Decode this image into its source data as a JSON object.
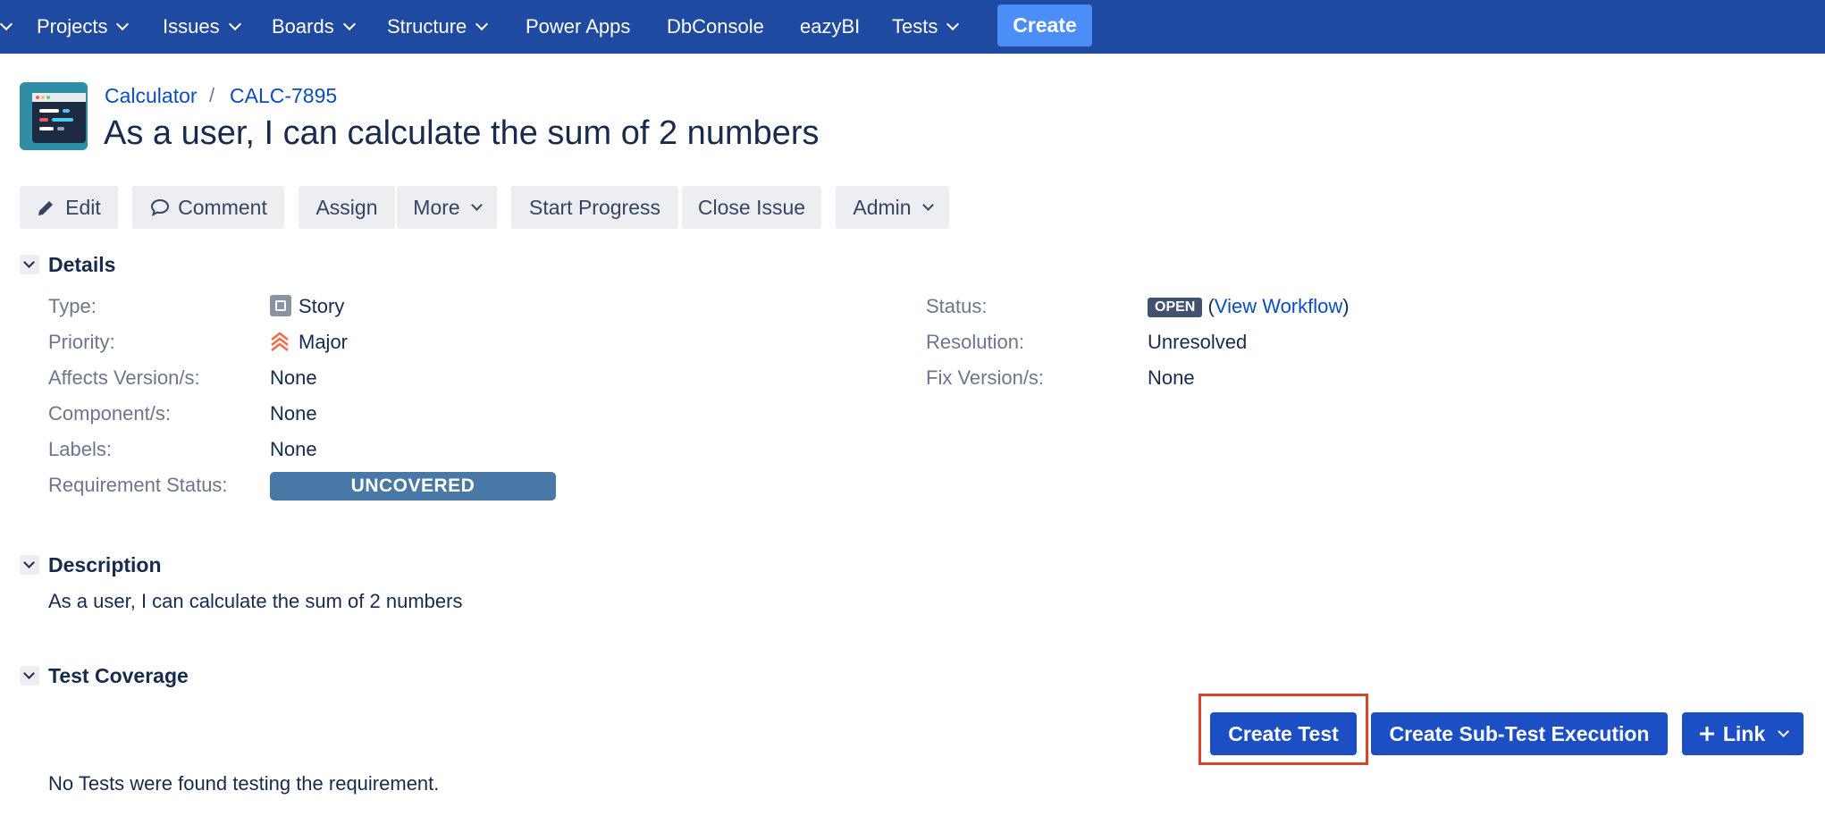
{
  "nav": {
    "items": [
      {
        "label": "Projects",
        "dropdown": true
      },
      {
        "label": "Issues",
        "dropdown": true
      },
      {
        "label": "Boards",
        "dropdown": true
      },
      {
        "label": "Structure",
        "dropdown": true
      },
      {
        "label": "Power Apps",
        "dropdown": false
      },
      {
        "label": "DbConsole",
        "dropdown": false
      },
      {
        "label": "eazyBI",
        "dropdown": false
      },
      {
        "label": "Tests",
        "dropdown": true
      }
    ],
    "create_label": "Create"
  },
  "breadcrumb": {
    "project": "Calculator",
    "separator": "/",
    "issue_key": "CALC-7895"
  },
  "issue": {
    "title": "As a user, I can calculate the sum of 2 numbers"
  },
  "toolbar": {
    "edit": "Edit",
    "comment": "Comment",
    "assign": "Assign",
    "more": "More",
    "start_progress": "Start Progress",
    "close_issue": "Close Issue",
    "admin": "Admin"
  },
  "details": {
    "heading": "Details",
    "type_label": "Type:",
    "type_value": "Story",
    "priority_label": "Priority:",
    "priority_value": "Major",
    "affects_label": "Affects Version/s:",
    "affects_value": "None",
    "components_label": "Component/s:",
    "components_value": "None",
    "labels_label": "Labels:",
    "labels_value": "None",
    "req_status_label": "Requirement Status:",
    "req_status_value": "UNCOVERED",
    "status_label": "Status:",
    "status_value": "OPEN",
    "view_workflow": "View Workflow",
    "resolution_label": "Resolution:",
    "resolution_value": "Unresolved",
    "fix_label": "Fix Version/s:",
    "fix_value": "None"
  },
  "description": {
    "heading": "Description",
    "text": "As a user, I can calculate the sum of 2 numbers"
  },
  "coverage": {
    "heading": "Test Coverage",
    "create_test": "Create Test",
    "create_sub_test_execution": "Create Sub-Test Execution",
    "link": "Link",
    "empty_text": "No Tests were found testing the requirement."
  },
  "colors": {
    "nav_bg": "#1f4aa1",
    "primary_button": "#1d4fc4",
    "uncovered": "#4a78a6",
    "highlight": "#e0412a"
  }
}
